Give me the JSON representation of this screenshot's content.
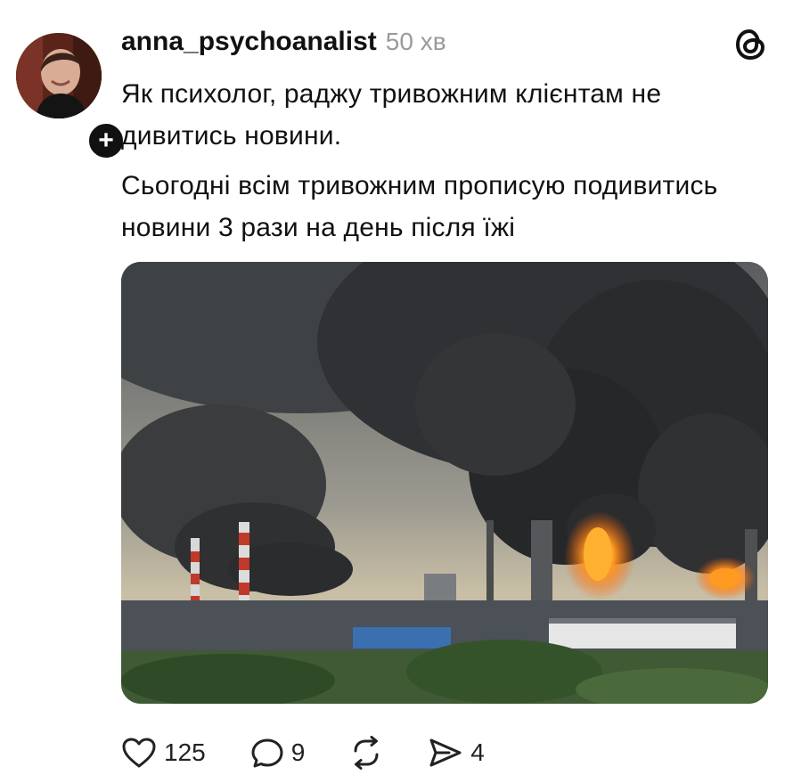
{
  "post": {
    "username": "anna_psychoanalist",
    "timestamp": "50 хв",
    "paragraphs": [
      "Як психолог, раджу тривожним клієнтам не дивитись новини.",
      "Сьогодні всім тривожним прописую подивитись новини 3 рази на день після їжі"
    ],
    "follow_badge": "+"
  },
  "actions": {
    "likes": "125",
    "replies": "9",
    "shares": "4"
  },
  "icons": {
    "like": "heart-icon",
    "reply": "speech-bubble-icon",
    "repost": "repost-arrows-icon",
    "share": "paper-plane-icon",
    "brand": "threads-logo-icon"
  },
  "colors": {
    "text": "#111111",
    "muted": "#9a9a9a",
    "fire": "#ff7a10"
  }
}
